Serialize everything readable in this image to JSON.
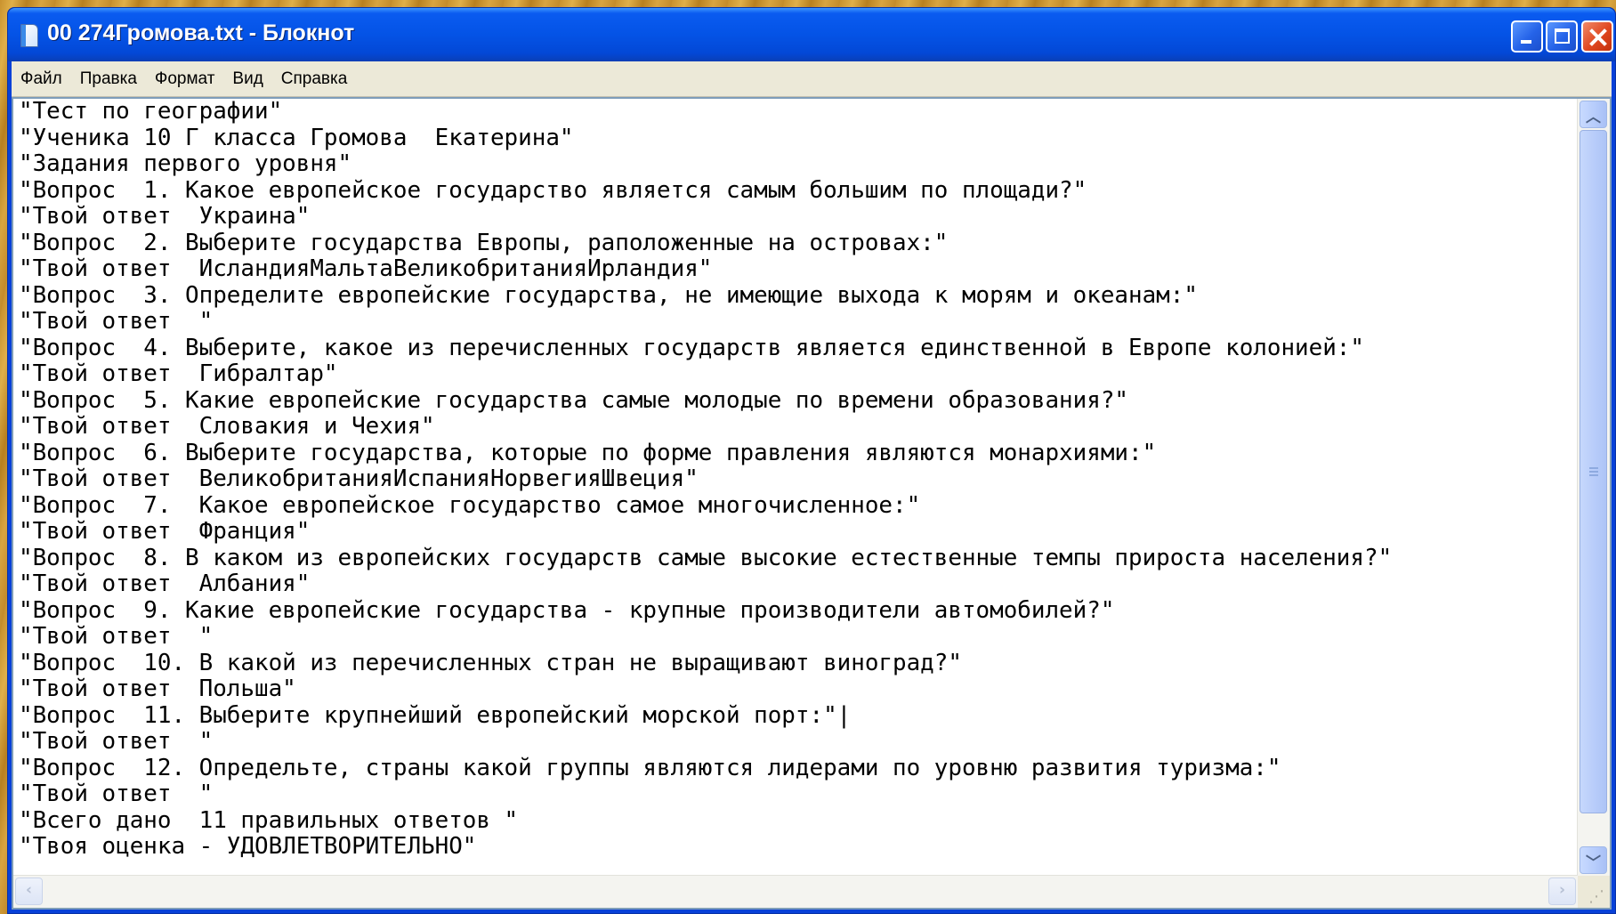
{
  "window": {
    "title": "00 274Громова.txt - Блокнот"
  },
  "menu": [
    "Файл",
    "Правка",
    "Формат",
    "Вид",
    "Справка"
  ],
  "document": {
    "lines": [
      "\"Тест по географии\"",
      "\"Ученика 10 Г класса Громова  Екатерина\"",
      "\"Задания первого уровня\"",
      "\"Вопрос  1. Какое европейское государство является самым большим по площади?\"",
      "\"Твой ответ  Украина\"",
      "\"Вопрос  2. Выберите государства Европы, раположенные на островах:\"",
      "\"Твой ответ  ИсландияМальтаВеликобританияИрландия\"",
      "\"Вопрос  3. Определите европейские государства, не имеющие выхода к морям и океанам:\"",
      "\"Твой ответ  \"",
      "\"Вопрос  4. Выберите, какое из перечисленных государств является единственной в Европе колонией:\"",
      "\"Твой ответ  Гибралтар\"",
      "\"Вопрос  5. Какие европейские государства самые молодые по времени образования?\"",
      "\"Твой ответ  Словакия и Чехия\"",
      "\"Вопрос  6. Выберите государства, которые по форме правления являются монархиями:\"",
      "\"Твой ответ  ВеликобританияИспанияНорвегияШвеция\"",
      "\"Вопрос  7.  Какое европейское государство самое многочисленное:\"",
      "\"Твой ответ  Франция\"",
      "\"Вопрос  8. В каком из европейских государств самые высокие естественные темпы прироста населения?\"",
      "\"Твой ответ  Албания\"",
      "\"Вопрос  9. Какие европейские государства - крупные производители автомобилей?\"",
      "\"Твой ответ  \"",
      "\"Вопрос  10. В какой из перечисленных стран не выращивают виноград?\"",
      "\"Твой ответ  Польша\"",
      "\"Вопрос  11. Выберите крупнейший европейский морской порт:\"|",
      "\"Твой ответ  \"",
      "\"Вопрос  12. Определьте, страны какой группы являются лидерами по уровню развития туризма:\"",
      "\"Твой ответ  \"",
      "\"Всего дано  11 правильных ответов \"",
      "\"Твоя оценка - УДОВЛЕТВОРИТЕЛЬНО\""
    ]
  }
}
